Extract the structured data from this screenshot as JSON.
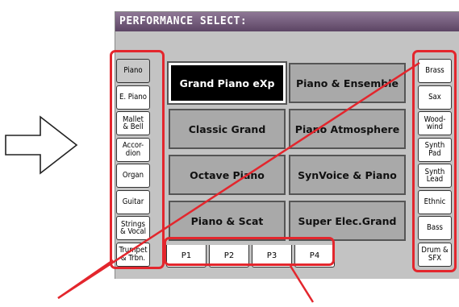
{
  "title": "PERFORMANCE SELECT:",
  "left_buttons": [
    {
      "label": "Piano",
      "selected": true
    },
    {
      "label": "E. Piano",
      "selected": false
    },
    {
      "label": "Mallet\n& Bell",
      "selected": false
    },
    {
      "label": "Accor-\ndion",
      "selected": false
    },
    {
      "label": "Organ",
      "selected": false
    },
    {
      "label": "Guitar",
      "selected": false
    },
    {
      "label": "Strings\n& Vocal",
      "selected": false
    },
    {
      "label": "Trumpet\n& Trbn.",
      "selected": false
    }
  ],
  "right_buttons": [
    {
      "label": "Brass"
    },
    {
      "label": "Sax"
    },
    {
      "label": "Wood-\nwind"
    },
    {
      "label": "Synth\nPad"
    },
    {
      "label": "Synth\nLead"
    },
    {
      "label": "Ethnic"
    },
    {
      "label": "Bass"
    },
    {
      "label": "Drum &\nSFX"
    }
  ],
  "performances": [
    {
      "label": "Grand Piano eXp",
      "selected": true
    },
    {
      "label": "Piano & Ensemble",
      "selected": false
    },
    {
      "label": "Classic Grand",
      "selected": false
    },
    {
      "label": "Piano Atmosphere",
      "selected": false
    },
    {
      "label": "Octave Piano",
      "selected": false
    },
    {
      "label": "SynVoice & Piano",
      "selected": false
    },
    {
      "label": "Piano & Scat",
      "selected": false
    },
    {
      "label": "Super Elec.Grand",
      "selected": false
    }
  ],
  "pages": [
    {
      "label": "P1",
      "selected": true
    },
    {
      "label": "P2",
      "selected": false
    },
    {
      "label": "P3",
      "selected": false
    },
    {
      "label": "P4",
      "selected": false
    }
  ],
  "colors": {
    "annotation": "#e3262d",
    "titlebar": "#6e5776"
  }
}
